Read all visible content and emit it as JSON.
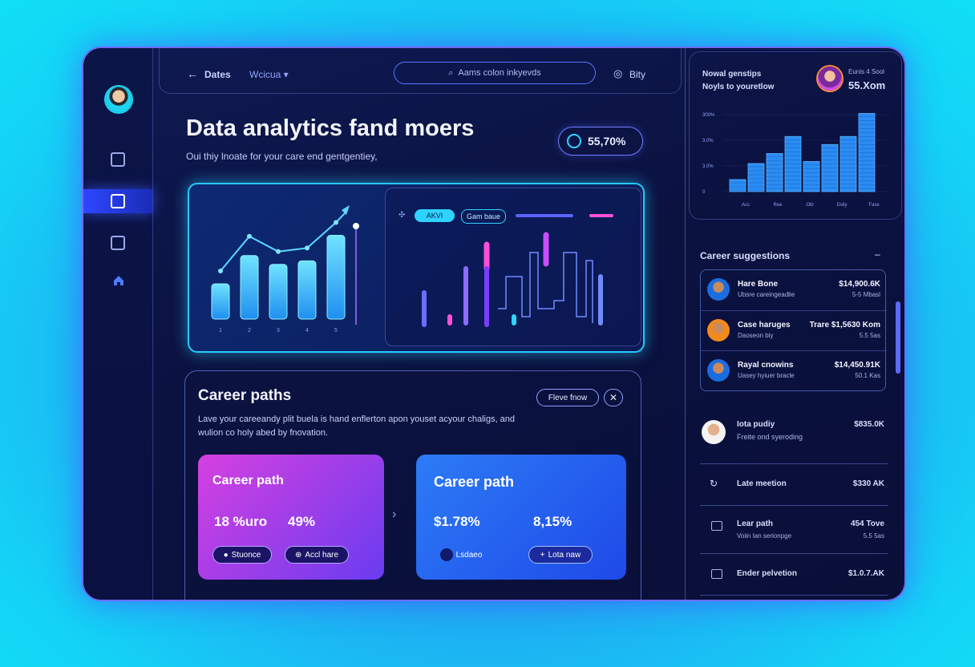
{
  "topbar": {
    "back_label": "Dates",
    "dropdown_label": "Wcicua",
    "search_placeholder": "Aams colon inkyevds",
    "right_label": "Bity"
  },
  "main": {
    "title": "Data analytics fand moers",
    "subtitle": "Oui thiy lnoate for your care end gentgentiey,",
    "kpi_value": "55,70%",
    "chart_tags": [
      "AKVI",
      "Gam baue"
    ]
  },
  "career_paths": {
    "title": "Career paths",
    "description": "Lave your careeandy plit buela is hand enflerton apon youset acyour chaligs, and wulion co holy abed by fnovation.",
    "more_button": "Fleve fnow",
    "cards": [
      {
        "title": "Career path",
        "value_1": "18 %uro",
        "value_2": "49%",
        "button_1": "Stuonce",
        "button_2": "Accl hare",
        "color_from": "#d640e0",
        "color_to": "#6a3cf0"
      },
      {
        "title": "Career path",
        "value_1": "$1.78%",
        "value_2": "8,15%",
        "button_1": "Lsdaeo",
        "button_2": "Lota naw",
        "color_from": "#2c7cf6",
        "color_to": "#1f49e8"
      }
    ]
  },
  "right_panel": {
    "header_line1": "Nowal genstips",
    "header_line2": "Noyls to youretlow",
    "profile_label": "Eunis 4 Sool",
    "profile_value": "55.Xom",
    "mini_chart": {
      "y_ticks": [
        "300%",
        "3.0%",
        "3.0%",
        "0"
      ],
      "x_ticks": [
        "Acc",
        "Ree",
        "Olb",
        "Dsily",
        "Fase"
      ],
      "values": [
        12,
        28,
        38,
        55,
        30,
        47,
        55,
        78
      ]
    },
    "suggestions_title": "Career suggestions",
    "suggestions": [
      {
        "name": "Hare Bone",
        "sub": "Ubsre careingeadlie",
        "value": "$14,900.6K",
        "sub2": "5-5 Mbasl",
        "color": "#1a6de0"
      },
      {
        "name": "Case haruges",
        "sub": "Daoseon biy",
        "value": "Trare $1,5630 Kom",
        "sub2": "5.5 5as",
        "color": "#f08a1c"
      },
      {
        "name": "Rayal cnowins",
        "sub": "Uasey hyiuer bracle",
        "value": "$14,450.91K",
        "sub2": "50.1 Kas",
        "color": "#1a6de0"
      }
    ],
    "list": [
      {
        "name": "Iota pudiy",
        "sub": "Freite ond syeroding",
        "value": "$835.0K",
        "icon": "person-avatar"
      },
      {
        "name": "Late meetion",
        "sub": "",
        "value": "$330 AK",
        "icon": "refresh-icon"
      },
      {
        "name": "Lear path",
        "sub": "Voiin Ian serionpge",
        "value": "454 Tove",
        "sub2": "5.5 5as",
        "icon": "chat-icon"
      },
      {
        "name": "Ender pelvetion",
        "sub": "",
        "value": "$1.0.7.AK",
        "icon": "card-icon"
      }
    ]
  },
  "chart_data": [
    {
      "type": "bar",
      "categories": [
        "1",
        "2",
        "3",
        "4",
        "5"
      ],
      "values": [
        40,
        72,
        62,
        66,
        95
      ],
      "title": "",
      "xlabel": "",
      "ylabel": ""
    },
    {
      "type": "bar",
      "categories": [
        "Acc",
        "Ree",
        "Olb",
        "Dsily",
        "Fase"
      ],
      "values": [
        12,
        28,
        38,
        55,
        30,
        47,
        55,
        78
      ],
      "title": "",
      "xlabel": "",
      "ylabel": ""
    }
  ]
}
